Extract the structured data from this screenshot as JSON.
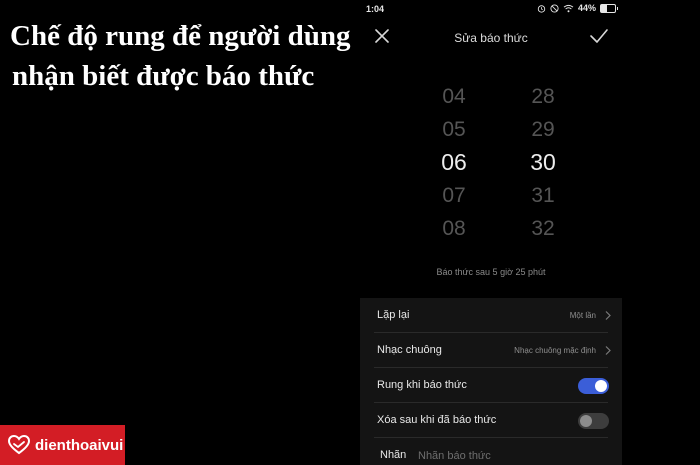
{
  "caption": {
    "line1": "Chế độ rung để người dùng",
    "line2": "nhận biết được báo thức"
  },
  "status_bar": {
    "time": "1:04",
    "battery": "44%",
    "battery_level": 0.44
  },
  "header": {
    "title": "Sửa báo thức"
  },
  "picker": {
    "hours": [
      "04",
      "05",
      "06",
      "07",
      "08"
    ],
    "minutes": [
      "28",
      "29",
      "30",
      "31",
      "32"
    ]
  },
  "hint": "Báo thức sau 5 giờ 25 phút",
  "settings": {
    "repeat": {
      "label": "Lặp lại",
      "value": "Một lần"
    },
    "ringtone": {
      "label": "Nhạc chuông",
      "value": "Nhạc chuông mặc định"
    },
    "vibrate": {
      "label": "Rung khi báo thức",
      "on": true
    },
    "delete_after": {
      "label": "Xóa sau khi đã báo thức",
      "on": false
    },
    "label_field": {
      "label": "Nhãn",
      "placeholder": "Nhãn báo thức"
    }
  },
  "logo": {
    "text": "dienthoaivui"
  },
  "colors": {
    "toggle_on": "#3b5ed8",
    "toggle_off": "#3d3d3d",
    "brand_red": "#d31d25"
  }
}
